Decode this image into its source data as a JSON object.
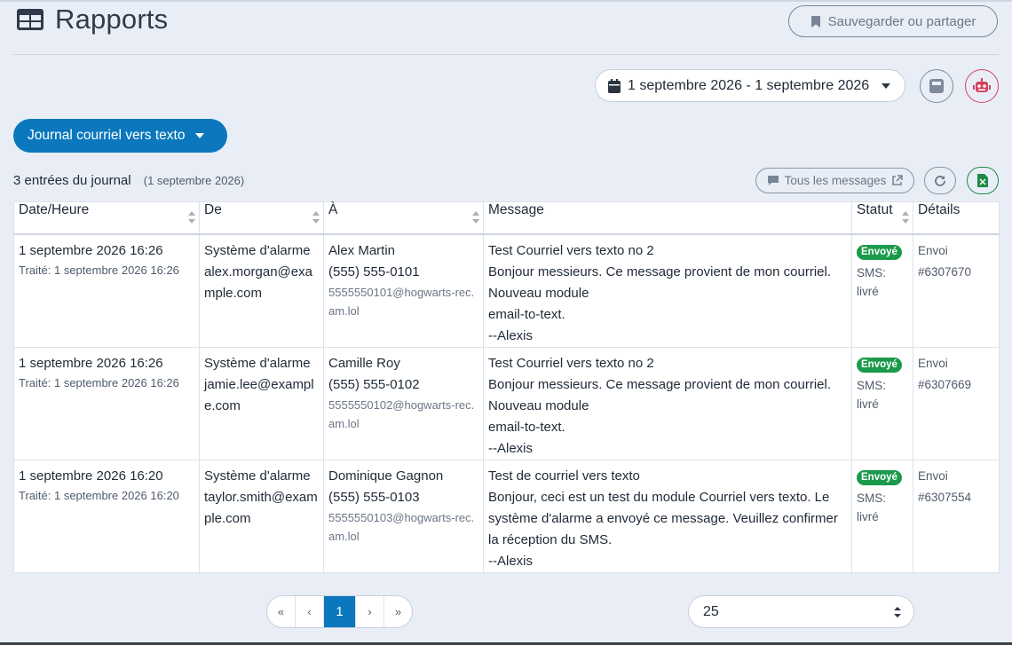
{
  "header": {
    "title": "Rapports",
    "save_label": "Sauvegarder ou partager"
  },
  "toolbar": {
    "date_range": "1 septembre 2026 - 1 septembre 2026"
  },
  "report": {
    "selected": "Journal courriel vers texto"
  },
  "log": {
    "count_label": "3 entrées du journal",
    "date_label": "(1 septembre 2026)",
    "all_messages_label": "Tous les messages"
  },
  "table": {
    "columns": [
      "Date/Heure",
      "De",
      "À",
      "Message",
      "Statut",
      "Détails"
    ],
    "rows": [
      {
        "datetime": "1 septembre 2026 16:26",
        "processed": "Traité: 1 septembre 2026 16:26",
        "from_name": "Système d'alarme",
        "from_email": "alex.morgan@example.com",
        "to_name": "Alex Martin",
        "to_phone": "(555) 555-0101",
        "to_email": "5555550101@hogwarts-rec.am.lol",
        "message_lines": [
          "Test Courriel vers texto no 2",
          "Bonjour messieurs. Ce message provient de mon courriel. Nouveau module",
          "email-to-text.",
          "--Alexis"
        ],
        "status_badge": "Envoyé",
        "status_sub": "SMS: livré",
        "details": "Envoi #6307670"
      },
      {
        "datetime": "1 septembre 2026 16:26",
        "processed": "Traité: 1 septembre 2026 16:26",
        "from_name": "Système d'alarme",
        "from_email": "jamie.lee@example.com",
        "to_name": "Camille Roy",
        "to_phone": "(555) 555-0102",
        "to_email": "5555550102@hogwarts-rec.am.lol",
        "message_lines": [
          "Test Courriel vers texto no 2",
          "Bonjour messieurs. Ce message provient de mon courriel. Nouveau module",
          "email-to-text.",
          "--Alexis"
        ],
        "status_badge": "Envoyé",
        "status_sub": "SMS: livré",
        "details": "Envoi #6307669"
      },
      {
        "datetime": "1 septembre 2026 16:20",
        "processed": "Traité: 1 septembre 2026 16:20",
        "from_name": "Système d'alarme",
        "from_email": "taylor.smith@example.com",
        "to_name": "Dominique Gagnon",
        "to_phone": "(555) 555-0103",
        "to_email": "5555550103@hogwarts-rec.am.lol",
        "message_lines": [
          "Test de courriel vers texto",
          "Bonjour, ceci est un test du module Courriel vers texto. Le système d'alarme a envoyé ce message. Veuillez confirmer la réception du SMS.",
          "--Alexis"
        ],
        "status_badge": "Envoyé",
        "status_sub": "SMS: livré",
        "details": "Envoi #6307554"
      }
    ]
  },
  "pagination": {
    "first": "«",
    "prev": "‹",
    "current": "1",
    "next": "›",
    "last": "»"
  },
  "per_page": {
    "value": "25"
  },
  "colors": {
    "accent": "#0b78bd",
    "success": "#1b9a4b",
    "robot": "#d2445f",
    "excel": "#1f8a45"
  },
  "icons": [
    "grid-icon",
    "bookmark-icon",
    "calendar-icon",
    "calculator-icon",
    "robot-icon",
    "comment-icon",
    "external-link-icon",
    "refresh-icon",
    "excel-icon"
  ]
}
